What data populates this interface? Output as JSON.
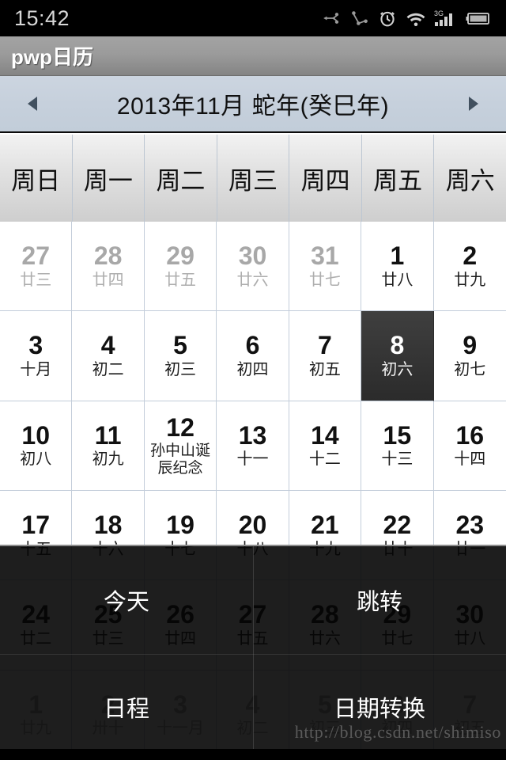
{
  "statusbar": {
    "time": "15:42",
    "icons": [
      "usb-icon",
      "share-icon",
      "alarm-clock-icon",
      "wifi-icon",
      "signal-3g-icon",
      "battery-icon"
    ]
  },
  "titlebar": {
    "app_title": "pwp日历"
  },
  "monthbar": {
    "prev_label": "◀",
    "next_label": "▶",
    "title": "2013年11月  蛇年(癸巳年)"
  },
  "weekdays": [
    "周日",
    "周一",
    "周二",
    "周三",
    "周四",
    "周五",
    "周六"
  ],
  "calendar": {
    "days": [
      {
        "num": "27",
        "lunar": "廿三",
        "other": true
      },
      {
        "num": "28",
        "lunar": "廿四",
        "other": true
      },
      {
        "num": "29",
        "lunar": "廿五",
        "other": true
      },
      {
        "num": "30",
        "lunar": "廿六",
        "other": true
      },
      {
        "num": "31",
        "lunar": "廿七",
        "other": true
      },
      {
        "num": "1",
        "lunar": "廿八",
        "other": false
      },
      {
        "num": "2",
        "lunar": "廿九",
        "other": false
      },
      {
        "num": "3",
        "lunar": "十月",
        "other": false
      },
      {
        "num": "4",
        "lunar": "初二",
        "other": false
      },
      {
        "num": "5",
        "lunar": "初三",
        "other": false
      },
      {
        "num": "6",
        "lunar": "初四",
        "other": false
      },
      {
        "num": "7",
        "lunar": "初五",
        "other": false
      },
      {
        "num": "8",
        "lunar": "初六",
        "other": false,
        "selected": true
      },
      {
        "num": "9",
        "lunar": "初七",
        "other": false
      },
      {
        "num": "10",
        "lunar": "初八",
        "other": false
      },
      {
        "num": "11",
        "lunar": "初九",
        "other": false
      },
      {
        "num": "12",
        "lunar": "孙中山诞辰纪念",
        "other": false,
        "festival": true
      },
      {
        "num": "13",
        "lunar": "十一",
        "other": false
      },
      {
        "num": "14",
        "lunar": "十二",
        "other": false
      },
      {
        "num": "15",
        "lunar": "十三",
        "other": false
      },
      {
        "num": "16",
        "lunar": "十四",
        "other": false
      },
      {
        "num": "17",
        "lunar": "十五",
        "other": false
      },
      {
        "num": "18",
        "lunar": "十六",
        "other": false
      },
      {
        "num": "19",
        "lunar": "十七",
        "other": false
      },
      {
        "num": "20",
        "lunar": "十八",
        "other": false
      },
      {
        "num": "21",
        "lunar": "十九",
        "other": false
      },
      {
        "num": "22",
        "lunar": "廿十",
        "other": false
      },
      {
        "num": "23",
        "lunar": "廿一",
        "other": false
      },
      {
        "num": "24",
        "lunar": "廿二",
        "other": false
      },
      {
        "num": "25",
        "lunar": "廿三",
        "other": false
      },
      {
        "num": "26",
        "lunar": "廿四",
        "other": false
      },
      {
        "num": "27",
        "lunar": "廿五",
        "other": false
      },
      {
        "num": "28",
        "lunar": "廿六",
        "other": false
      },
      {
        "num": "29",
        "lunar": "廿七",
        "other": false
      },
      {
        "num": "30",
        "lunar": "廿八",
        "other": false
      },
      {
        "num": "1",
        "lunar": "廿九",
        "other": true
      },
      {
        "num": "2",
        "lunar": "卅十",
        "other": true
      },
      {
        "num": "3",
        "lunar": "十一月",
        "other": true
      },
      {
        "num": "4",
        "lunar": "初二",
        "other": true
      },
      {
        "num": "5",
        "lunar": "初三",
        "other": true
      },
      {
        "num": "6",
        "lunar": "初四",
        "other": true
      },
      {
        "num": "7",
        "lunar": "初五",
        "other": true
      }
    ]
  },
  "menu": {
    "items": [
      "今天",
      "跳转",
      "日程",
      "日期转换"
    ]
  },
  "watermark": "http://blog.csdn.net/shimiso",
  "colors": {
    "titlebar": "#9b9b9b",
    "monthbar": "#c6d0dc",
    "selected_day": "#343434",
    "menu_overlay": "#060606"
  }
}
